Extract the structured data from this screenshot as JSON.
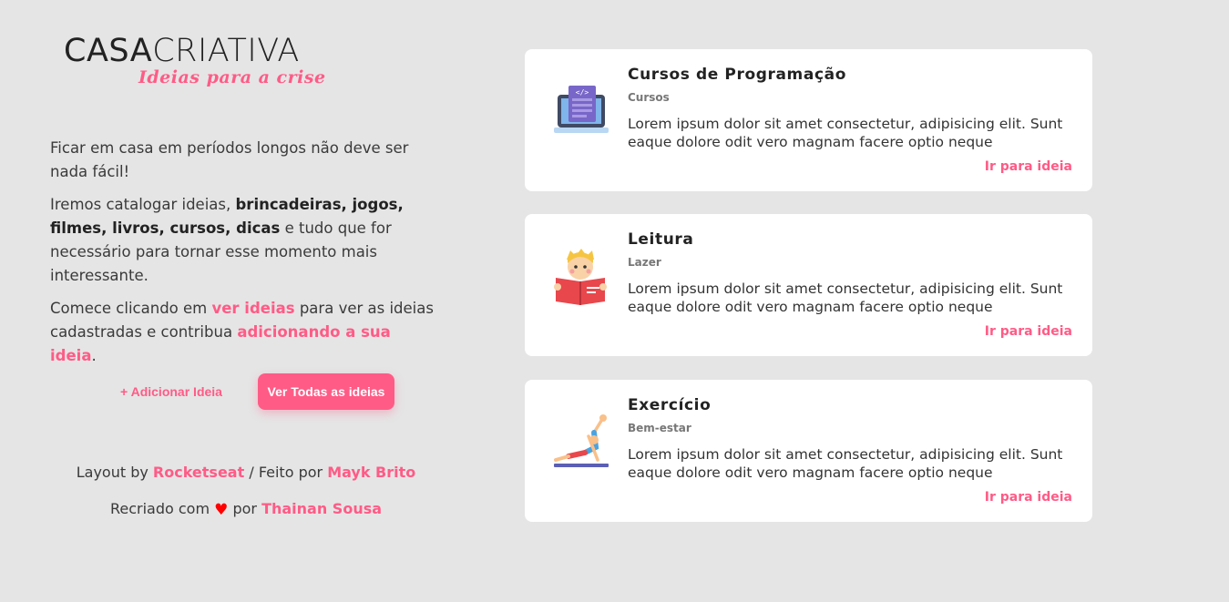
{
  "logo": {
    "main_bold": "CASA",
    "main_thin": "CRIATIVA",
    "tagline": "Ideias para a crise"
  },
  "intro": {
    "p1": "Ficar em casa em períodos longos não deve ser nada fácil!",
    "p2_a": "Iremos catalogar ideias, ",
    "p2_bold": "brincadeiras, jogos, filmes, livros, cursos, dicas",
    "p2_b": " e tudo que for necessário para tornar esse momento mais interessante.",
    "p3_a": "Comece clicando em ",
    "p3_link1": "ver ideias",
    "p3_b": " para ver as ideias cadastradas e contribua ",
    "p3_link2": "adicionando a sua ideia",
    "p3_c": "."
  },
  "buttons": {
    "add": "+ Adicionar Ideia",
    "all": "Ver Todas as ideias"
  },
  "footer": {
    "layout_by": "Layout by ",
    "layout_author": "Rocketseat",
    "made_by": " / Feito por ",
    "made_author": "Mayk Brito",
    "remade": "Recriado com ",
    "heart": "♥",
    "remade_by": " por ",
    "remade_author": "Thainan Sousa"
  },
  "colors": {
    "accent": "#ff5b86",
    "background": "#e5e5e5",
    "card": "#ffffff",
    "heart": "#ff0000"
  },
  "cards": [
    {
      "icon": "laptop-code-icon",
      "title": "Cursos de Programação",
      "category": "Cursos",
      "description": "Lorem ipsum dolor sit amet consectetur, adipisicing elit. Sunt eaque dolore odit vero magnam facere optio neque",
      "link": "Ir para ideia"
    },
    {
      "icon": "child-reading-icon",
      "title": "Leitura",
      "category": "Lazer",
      "description": "Lorem ipsum dolor sit amet consectetur, adipisicing elit. Sunt eaque dolore odit vero magnam facere optio neque",
      "link": "Ir para ideia"
    },
    {
      "icon": "yoga-exercise-icon",
      "title": "Exercício",
      "category": "Bem-estar",
      "description": "Lorem ipsum dolor sit amet consectetur, adipisicing elit. Sunt eaque dolore odit vero magnam facere optio neque",
      "link": "Ir para ideia"
    }
  ]
}
